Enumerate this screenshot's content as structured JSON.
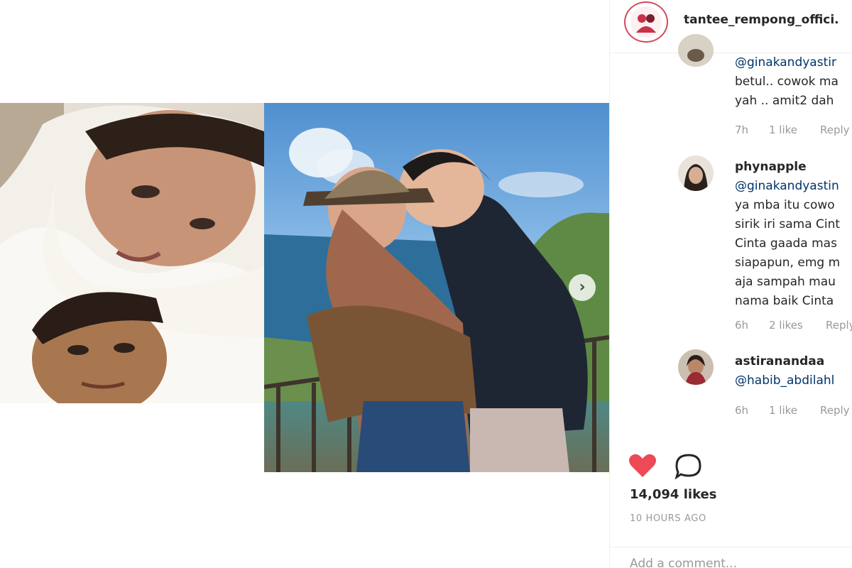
{
  "post": {
    "username": "tantee_rempong_offici.",
    "avatar_icon": "profile-logo-icon",
    "carousel_next_icon": "chevron-right-icon",
    "carousel_next_glyph": "›"
  },
  "comments": [
    {
      "username": "",
      "lines": [
        "@ginakandyastir",
        "betul.. cowok ma",
        "yah .. amit2 dah"
      ],
      "time": "7h",
      "likes": "1 like",
      "reply": "Reply"
    },
    {
      "username": "phynapple",
      "lines": [
        "@ginakandyastin",
        "ya mba itu cowo",
        "sirik iri sama Cint",
        "Cinta gaada mas",
        "siapapun, emg m",
        "aja sampah mau",
        "nama baik Cinta"
      ],
      "time": "6h",
      "likes": "2 likes",
      "reply": "Reply"
    },
    {
      "username": "astiranandaa",
      "lines": [
        "@habib_abdilahl"
      ],
      "time": "6h",
      "likes": "1 like",
      "reply": "Reply"
    }
  ],
  "actions": {
    "like_icon": "heart-icon",
    "comment_icon": "comment-bubble-icon",
    "like_color": "#ed4956"
  },
  "likes_count": "14,094 likes",
  "post_time": "10 HOURS AGO",
  "add_comment_placeholder": "Add a comment..."
}
